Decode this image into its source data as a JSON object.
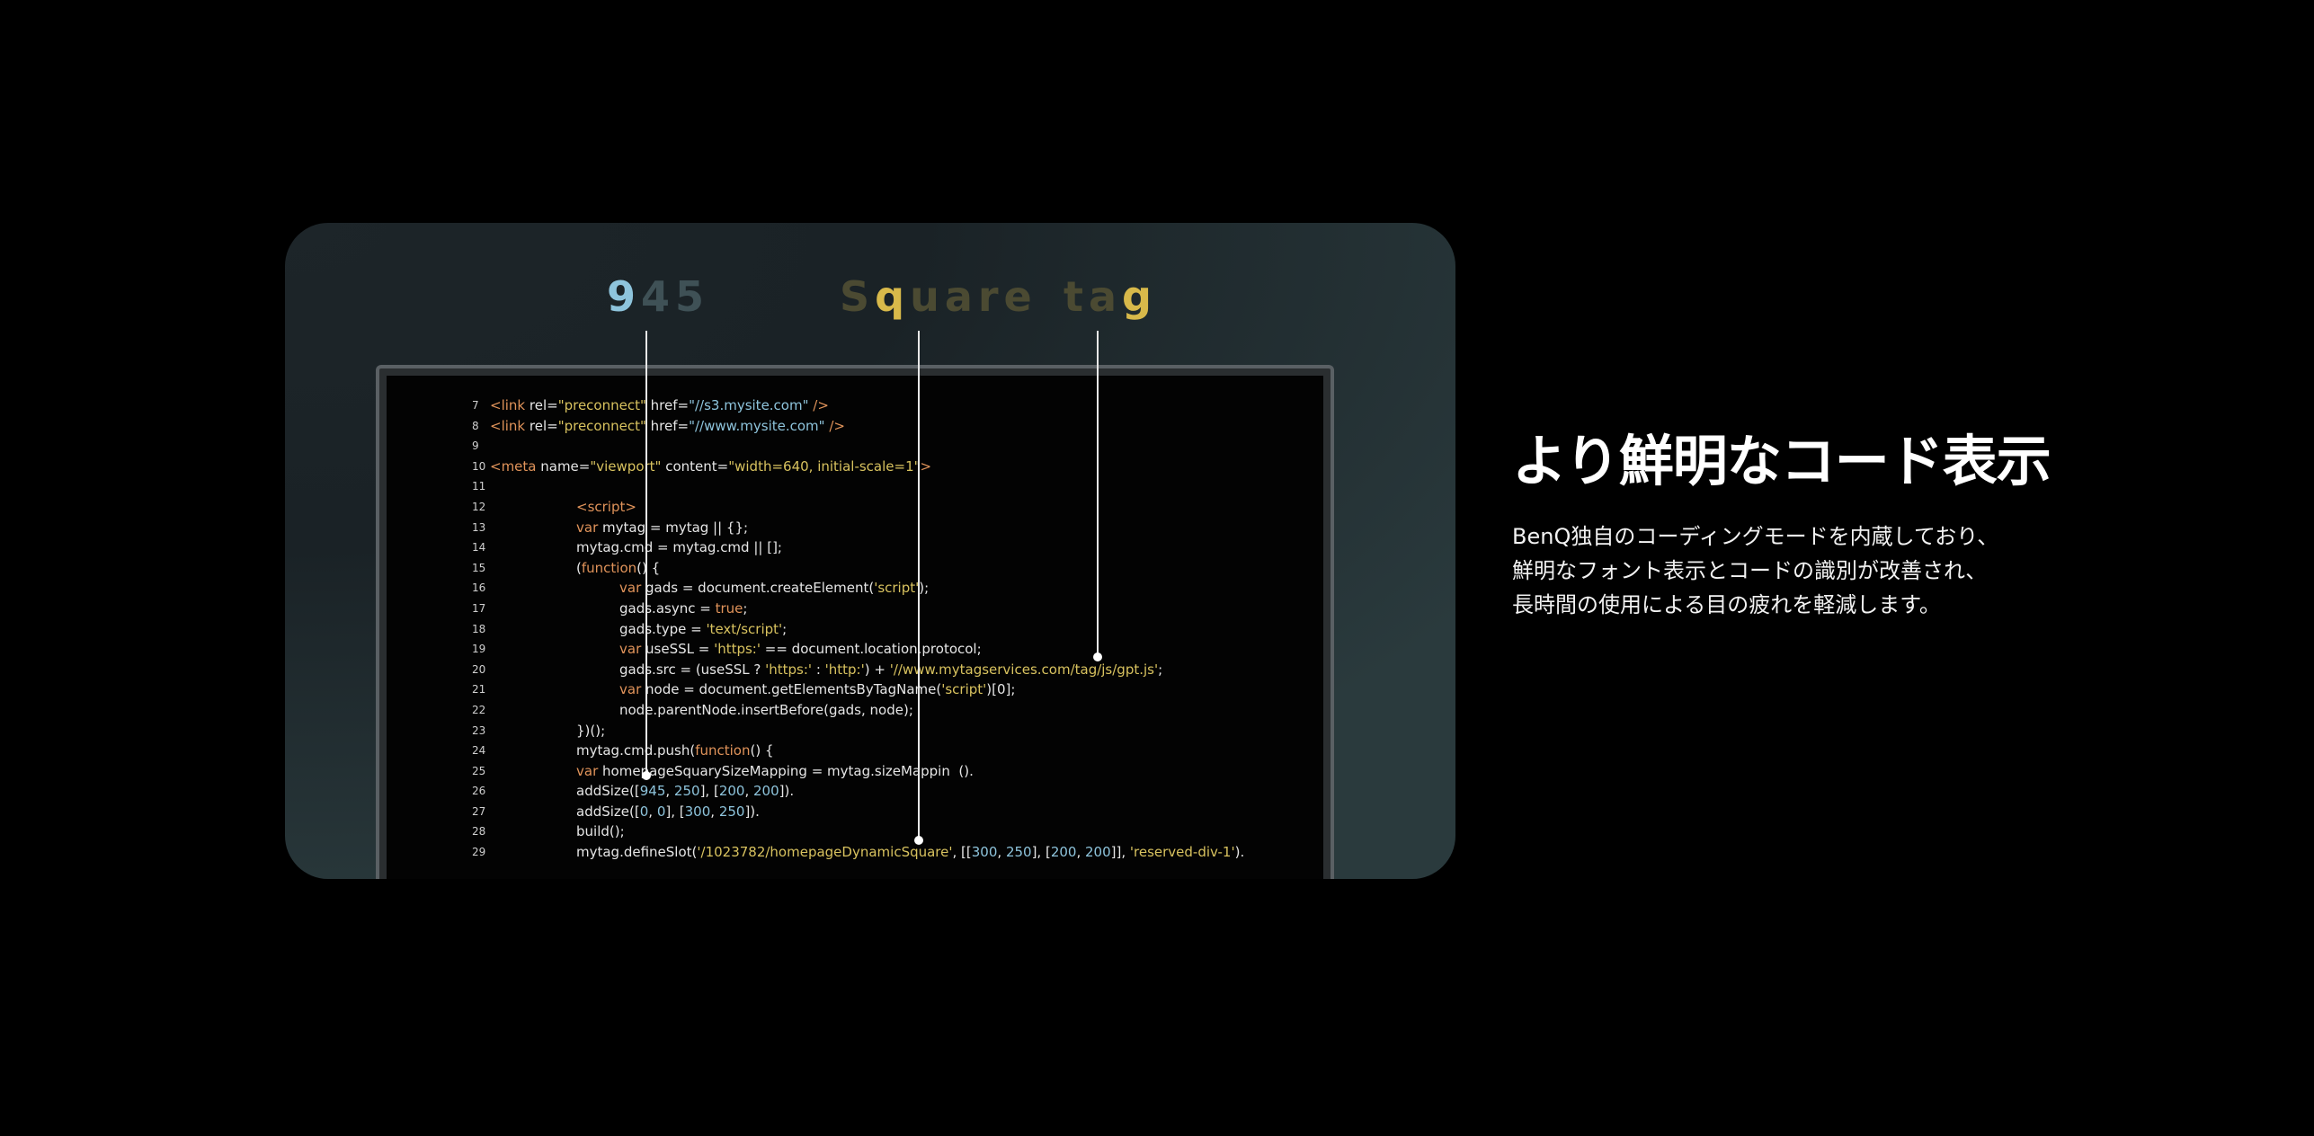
{
  "callouts": [
    {
      "name": "callout-945",
      "parts": [
        {
          "t": "9",
          "c": "hl-blue"
        },
        {
          "t": "45",
          "c": "dim-blue"
        }
      ]
    },
    {
      "name": "callout-square",
      "parts": [
        {
          "t": "S",
          "c": "dim-gold"
        },
        {
          "t": "q",
          "c": "hl-gold"
        },
        {
          "t": "uare",
          "c": "dim-gold"
        }
      ]
    },
    {
      "name": "callout-tag",
      "parts": [
        {
          "t": "ta",
          "c": "dim-gold"
        },
        {
          "t": "g",
          "c": "hl-gold"
        }
      ]
    }
  ],
  "code_lines": [
    {
      "n": "7",
      "indent": 0,
      "tokens": [
        [
          "<link ",
          "c-tag"
        ],
        [
          "rel=",
          "c-attr"
        ],
        [
          "\"preconnect\"",
          "c-str"
        ],
        [
          " href=",
          "c-attr"
        ],
        [
          "\"//s3.mysite.com\"",
          "c-url"
        ],
        [
          " />",
          "c-tag"
        ]
      ]
    },
    {
      "n": "8",
      "indent": 0,
      "tokens": [
        [
          "<link ",
          "c-tag"
        ],
        [
          "rel=",
          "c-attr"
        ],
        [
          "\"preconnect\"",
          "c-str"
        ],
        [
          " href=",
          "c-attr"
        ],
        [
          "\"//www.mysite.com\"",
          "c-url"
        ],
        [
          " />",
          "c-tag"
        ]
      ]
    },
    {
      "n": "9",
      "indent": 0,
      "tokens": []
    },
    {
      "n": "10",
      "indent": 0,
      "tokens": [
        [
          "<meta ",
          "c-tag"
        ],
        [
          "name=",
          "c-attr"
        ],
        [
          "\"viewport\"",
          "c-str"
        ],
        [
          " content=",
          "c-attr"
        ],
        [
          "\"width=640, initial-scale=1\"",
          "c-str"
        ],
        [
          ">",
          "c-tag"
        ]
      ]
    },
    {
      "n": "11",
      "indent": 0,
      "tokens": []
    },
    {
      "n": "12",
      "indent": 1,
      "tokens": [
        [
          "<script>",
          "c-tag"
        ]
      ]
    },
    {
      "n": "13",
      "indent": 1,
      "tokens": [
        [
          "var",
          "c-kw"
        ],
        [
          " mytag = mytag || {};",
          "c-txt"
        ]
      ]
    },
    {
      "n": "14",
      "indent": 1,
      "tokens": [
        [
          "mytag.cmd = mytag.cmd || [];",
          "c-txt"
        ]
      ]
    },
    {
      "n": "15",
      "indent": 1,
      "tokens": [
        [
          "(",
          "c-txt"
        ],
        [
          "function",
          "c-kw"
        ],
        [
          "() {",
          "c-txt"
        ]
      ]
    },
    {
      "n": "16",
      "indent": 2,
      "tokens": [
        [
          "var",
          "c-kw"
        ],
        [
          " gads = document.createElement(",
          "c-txt"
        ],
        [
          "'script'",
          "c-str"
        ],
        [
          ");",
          "c-txt"
        ]
      ]
    },
    {
      "n": "17",
      "indent": 2,
      "tokens": [
        [
          "gads.async = ",
          "c-txt"
        ],
        [
          "true",
          "c-kw"
        ],
        [
          ";",
          "c-txt"
        ]
      ]
    },
    {
      "n": "18",
      "indent": 2,
      "tokens": [
        [
          "gads.type = ",
          "c-txt"
        ],
        [
          "'text/script'",
          "c-str"
        ],
        [
          ";",
          "c-txt"
        ]
      ]
    },
    {
      "n": "19",
      "indent": 2,
      "tokens": [
        [
          "var",
          "c-kw"
        ],
        [
          " useSSL = ",
          "c-txt"
        ],
        [
          "'https:'",
          "c-str"
        ],
        [
          " == document.location.protocol;",
          "c-txt"
        ]
      ]
    },
    {
      "n": "20",
      "indent": 2,
      "tokens": [
        [
          "gads.src = (useSSL ? ",
          "c-txt"
        ],
        [
          "'https:'",
          "c-str"
        ],
        [
          " : ",
          "c-txt"
        ],
        [
          "'http:'",
          "c-str"
        ],
        [
          ") + ",
          "c-txt"
        ],
        [
          "'//www.mytagservices.com/tag/js/gpt.js'",
          "c-str"
        ],
        [
          ";",
          "c-txt"
        ]
      ]
    },
    {
      "n": "21",
      "indent": 2,
      "tokens": [
        [
          "var",
          "c-kw"
        ],
        [
          " node = document.getElementsByTagName(",
          "c-txt"
        ],
        [
          "'script'",
          "c-str"
        ],
        [
          ")[0];",
          "c-txt"
        ]
      ]
    },
    {
      "n": "22",
      "indent": 2,
      "tokens": [
        [
          "node.parentNode.insertBefore(gads, node);",
          "c-txt"
        ]
      ]
    },
    {
      "n": "23",
      "indent": 1,
      "tokens": [
        [
          "})();",
          "c-txt"
        ]
      ]
    },
    {
      "n": "24",
      "indent": 1,
      "tokens": [
        [
          "mytag.cmd.push(",
          "c-txt"
        ],
        [
          "function",
          "c-kw"
        ],
        [
          "() {",
          "c-txt"
        ]
      ]
    },
    {
      "n": "25",
      "indent": 1,
      "tokens": [
        [
          "var",
          "c-kw"
        ],
        [
          " homepageSquarySizeMapping = mytag.sizeMappin  ().",
          "c-txt"
        ]
      ]
    },
    {
      "n": "26",
      "indent": 1,
      "tokens": [
        [
          "addSize([",
          "c-txt"
        ],
        [
          "945",
          "c-num"
        ],
        [
          ", ",
          "c-txt"
        ],
        [
          "250",
          "c-num"
        ],
        [
          "], [",
          "c-txt"
        ],
        [
          "200",
          "c-num"
        ],
        [
          ", ",
          "c-txt"
        ],
        [
          "200",
          "c-num"
        ],
        [
          "]).",
          "c-txt"
        ]
      ]
    },
    {
      "n": "27",
      "indent": 1,
      "tokens": [
        [
          "addSize([",
          "c-txt"
        ],
        [
          "0",
          "c-num"
        ],
        [
          ", ",
          "c-txt"
        ],
        [
          "0",
          "c-num"
        ],
        [
          "], [",
          "c-txt"
        ],
        [
          "300",
          "c-num"
        ],
        [
          ", ",
          "c-txt"
        ],
        [
          "250",
          "c-num"
        ],
        [
          "]).",
          "c-txt"
        ]
      ]
    },
    {
      "n": "28",
      "indent": 1,
      "tokens": [
        [
          "build();",
          "c-txt"
        ]
      ]
    },
    {
      "n": "29",
      "indent": 1,
      "tokens": [
        [
          "mytag.defineSlot(",
          "c-txt"
        ],
        [
          "'/1023782/homepageDynamicSquare'",
          "c-str"
        ],
        [
          ", [[",
          "c-txt"
        ],
        [
          "300",
          "c-num"
        ],
        [
          ", ",
          "c-txt"
        ],
        [
          "250",
          "c-num"
        ],
        [
          "], [",
          "c-txt"
        ],
        [
          "200",
          "c-num"
        ],
        [
          ", ",
          "c-txt"
        ],
        [
          "200",
          "c-num"
        ],
        [
          "]], ",
          "c-txt"
        ],
        [
          "'reserved-div-1'",
          "c-str"
        ],
        [
          ").",
          "c-txt"
        ]
      ]
    }
  ],
  "feature": {
    "title": "より鮮明なコード表示",
    "description_lines": [
      "BenQ独自のコーディングモードを内蔵しており、",
      "鮮明なフォント表示とコードの識別が改善され、",
      "長時間の使用による目の疲れを軽減します。"
    ]
  }
}
